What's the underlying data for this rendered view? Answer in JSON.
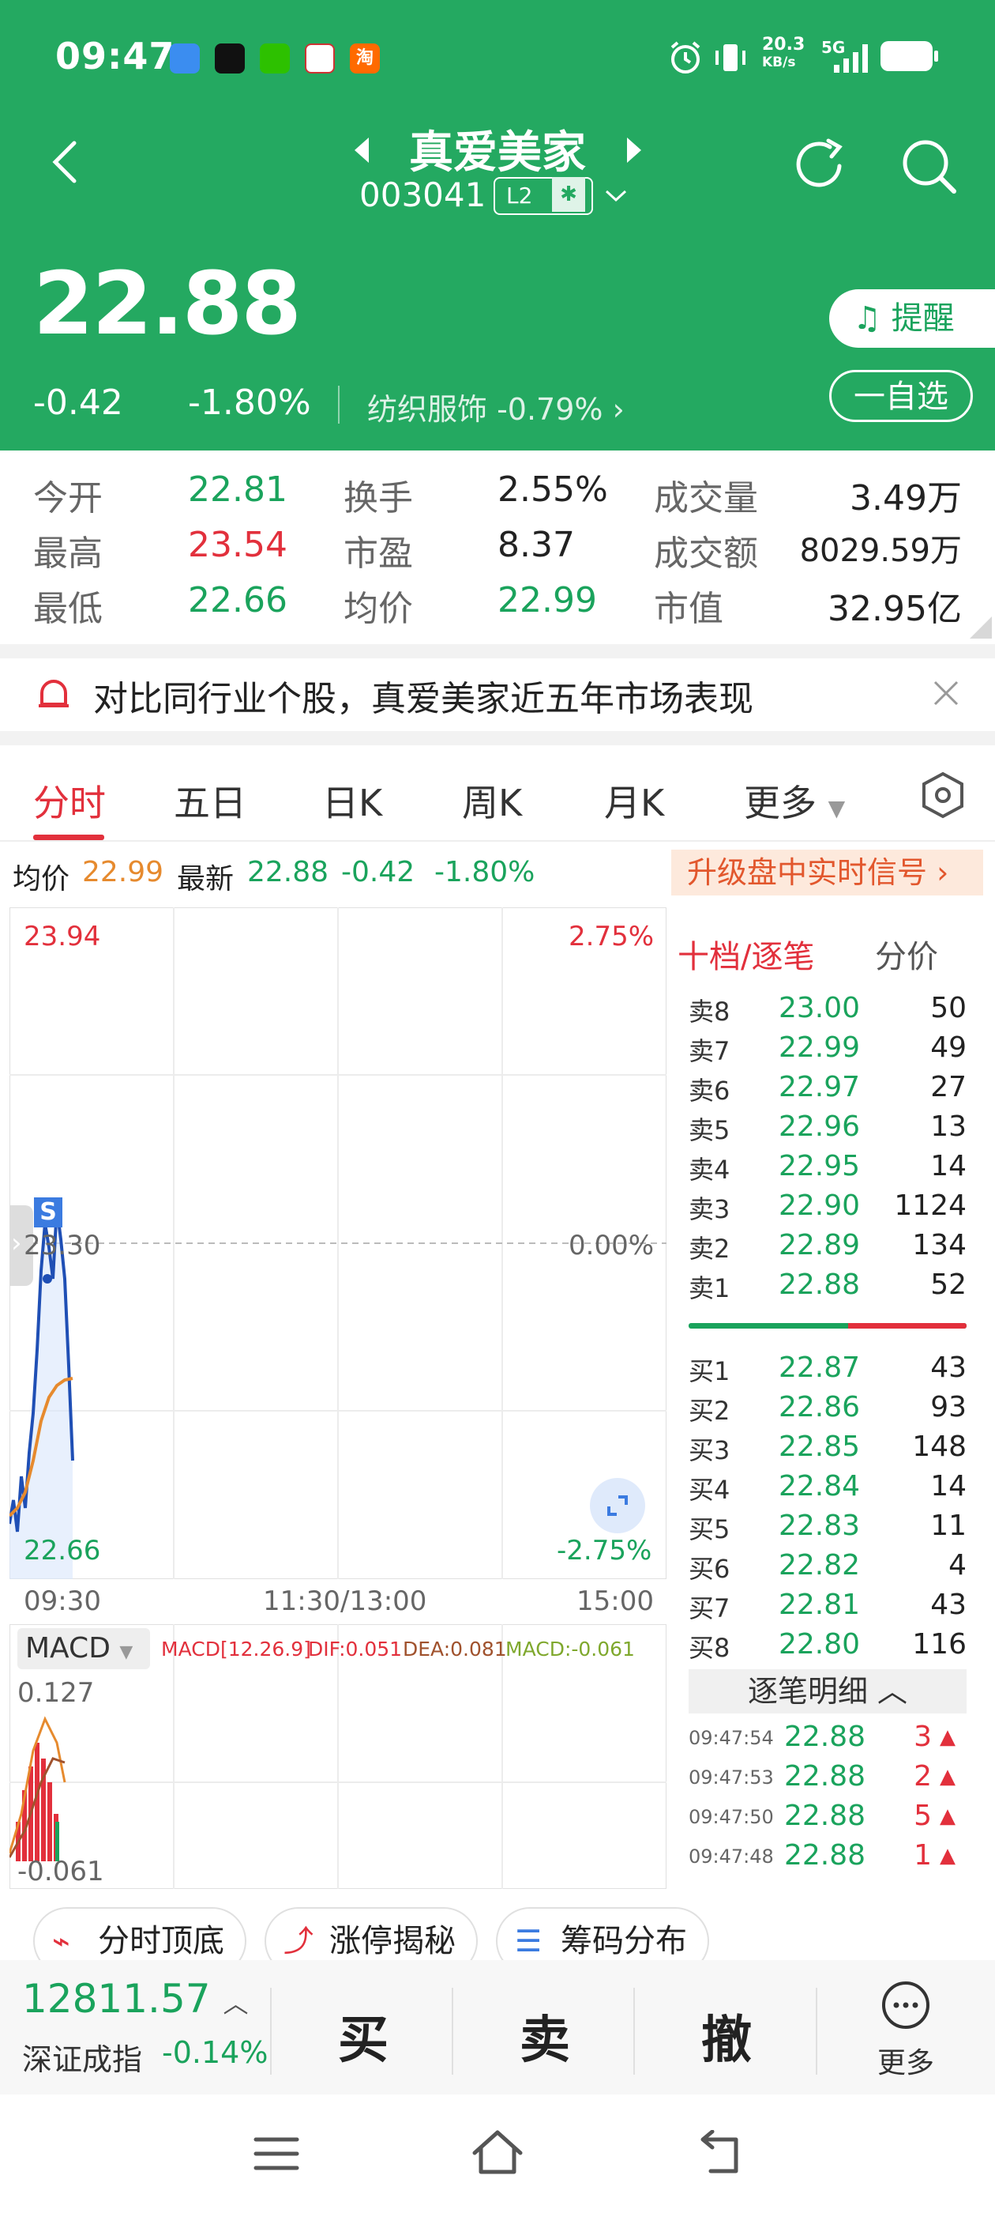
{
  "status_bar": {
    "time": "09:47",
    "app_icons": [
      "淘"
    ],
    "net_speed": "20.3",
    "net_unit": "KB/s",
    "network": "5G"
  },
  "header": {
    "stock_name": "真爱美家",
    "stock_code": "003041",
    "l2_badge": "L2",
    "price": "22.88",
    "change": "-0.42",
    "change_pct": "-1.80%",
    "industry": "纺织服饰 -0.79%",
    "remind_label": "提醒",
    "fav_label": "一自选"
  },
  "stats": [
    {
      "label": "今开",
      "value": "22.81",
      "color": "green"
    },
    {
      "label": "换手",
      "value": "2.55%",
      "color": "dark"
    },
    {
      "label": "成交量",
      "value": "3.49万",
      "color": "dark"
    },
    {
      "label": "最高",
      "value": "23.54",
      "color": "red"
    },
    {
      "label": "市盈",
      "value": "8.37",
      "color": "dark"
    },
    {
      "label": "成交额",
      "value": "8029.59万",
      "color": "dark"
    },
    {
      "label": "最低",
      "value": "22.66",
      "color": "green"
    },
    {
      "label": "均价",
      "value": "22.99",
      "color": "green"
    },
    {
      "label": "市值",
      "value": "32.95亿",
      "color": "dark"
    }
  ],
  "banner": {
    "text": "对比同行业个股，真爱美家近五年市场表现"
  },
  "tabs": [
    {
      "label": "分时",
      "active": true
    },
    {
      "label": "五日",
      "active": false
    },
    {
      "label": "日K",
      "active": false
    },
    {
      "label": "周K",
      "active": false
    },
    {
      "label": "月K",
      "active": false
    },
    {
      "label": "更多",
      "active": false
    }
  ],
  "info_line": {
    "avg_label": "均价",
    "avg_value": "22.99",
    "latest_label": "最新",
    "latest_value": "22.88",
    "change": "-0.42",
    "change_pct": "-1.80%",
    "upgrade_label": "升级盘中实时信号"
  },
  "chart": {
    "price_high": "23.94",
    "price_low": "22.66",
    "price_mid": "23.30",
    "pct_high": "2.75%",
    "pct_mid": "0.00%",
    "pct_low": "-2.75%",
    "signal": "S",
    "times": [
      "09:30",
      "11:30/13:00",
      "15:00"
    ]
  },
  "macd": {
    "selector": "MACD",
    "params": "MACD[12.26.9]",
    "dif": "DIF:0.051",
    "dea": "DEA:0.081",
    "macd_val": "MACD:-0.061",
    "axis_top": "0.127",
    "axis_bottom": "-0.061"
  },
  "order_book": {
    "tab_active": "十档/逐笔",
    "tab_other": "分价",
    "asks": [
      {
        "label": "卖8",
        "price": "23.00",
        "vol": "50"
      },
      {
        "label": "卖7",
        "price": "22.99",
        "vol": "49"
      },
      {
        "label": "卖6",
        "price": "22.97",
        "vol": "27"
      },
      {
        "label": "卖5",
        "price": "22.96",
        "vol": "13"
      },
      {
        "label": "卖4",
        "price": "22.95",
        "vol": "14"
      },
      {
        "label": "卖3",
        "price": "22.90",
        "vol": "1124"
      },
      {
        "label": "卖2",
        "price": "22.89",
        "vol": "134"
      },
      {
        "label": "卖1",
        "price": "22.88",
        "vol": "52"
      }
    ],
    "bids": [
      {
        "label": "买1",
        "price": "22.87",
        "vol": "43"
      },
      {
        "label": "买2",
        "price": "22.86",
        "vol": "93"
      },
      {
        "label": "买3",
        "price": "22.85",
        "vol": "148"
      },
      {
        "label": "买4",
        "price": "22.84",
        "vol": "14"
      },
      {
        "label": "买5",
        "price": "22.83",
        "vol": "11"
      },
      {
        "label": "买6",
        "price": "22.82",
        "vol": "4"
      },
      {
        "label": "买7",
        "price": "22.81",
        "vol": "43"
      },
      {
        "label": "买8",
        "price": "22.80",
        "vol": "116"
      }
    ],
    "detail_label": "逐笔明细",
    "ticks": [
      {
        "time": "09:47:54",
        "price": "22.88",
        "vol": "3"
      },
      {
        "time": "09:47:53",
        "price": "22.88",
        "vol": "2"
      },
      {
        "time": "09:47:50",
        "price": "22.88",
        "vol": "5"
      },
      {
        "time": "09:47:48",
        "price": "22.88",
        "vol": "1"
      }
    ]
  },
  "tools": [
    {
      "label": "分时顶底"
    },
    {
      "label": "涨停揭秘"
    },
    {
      "label": "筹码分布"
    }
  ],
  "bottom": {
    "index_value": "12811.57",
    "index_name": "深证成指",
    "index_change": "-0.14%",
    "buy": "买",
    "sell": "卖",
    "cancel": "撤",
    "more": "更多"
  },
  "colors": {
    "brand_green": "#24a961",
    "down_green": "#1aa35c",
    "up_red": "#e2303c",
    "avg_orange": "#e68a2e",
    "price_line_blue": "#1f4fb5"
  }
}
